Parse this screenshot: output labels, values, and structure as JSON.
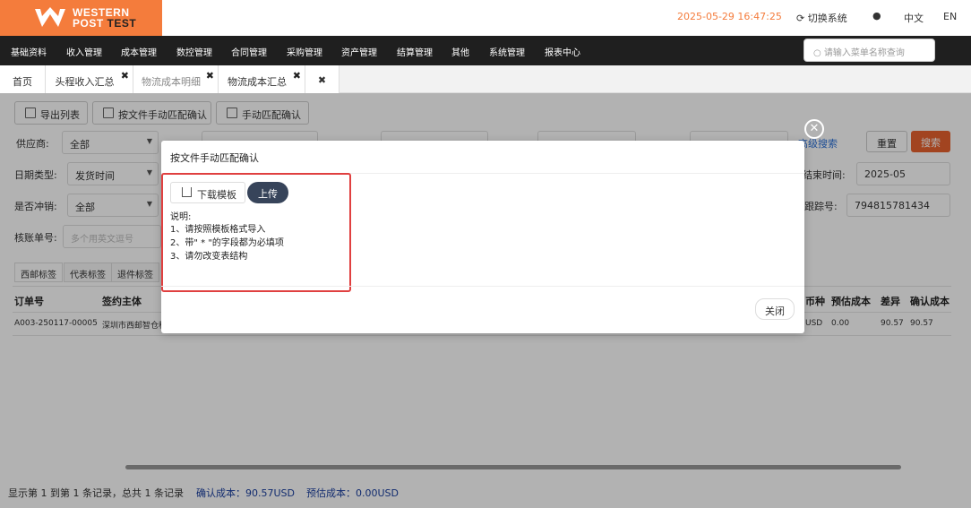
{
  "brand": {
    "line1": "WESTERN",
    "line2a": "POST ",
    "line2b": "TEST"
  },
  "header": {
    "clock": "2025-05-29 16:47:25",
    "switch_label": "切换系统",
    "lang_zh": "中文",
    "lang_en": "EN"
  },
  "menu": {
    "items": [
      "基础资料",
      "收入管理",
      "成本管理",
      "数控管理",
      "合同管理",
      "采购管理",
      "资产管理",
      "结算管理",
      "其他",
      "系统管理",
      "报表中心"
    ],
    "search_placeholder": "请输入菜单名称查询"
  },
  "tabs": [
    {
      "label": "首页"
    },
    {
      "label": "头程收入汇总"
    },
    {
      "label": "物流成本明细"
    },
    {
      "label": "物流成本汇总"
    }
  ],
  "toolbar": {
    "export": "导出列表",
    "file_match": "按文件手动匹配确认",
    "manual_match": "手动匹配确认"
  },
  "filters": {
    "supplier_label": "供应商:",
    "supplier_value": "全部",
    "date_type_label": "日期类型:",
    "date_type_value": "发货时间",
    "offset_label": "是否冲销:",
    "offset_value": "全部",
    "account_no_label": "核账单号:",
    "account_no_placeholder": "多个用英文逗号",
    "end_time_label": "结束时间:",
    "end_time_value": "2025-05",
    "tracking_label": "跟踪号:",
    "tracking_value": "794815781434",
    "advanced": "高级搜索",
    "reset": "重置",
    "search": "搜索"
  },
  "subtabs": [
    "西邮标签",
    "代表标签",
    "退件标签"
  ],
  "table": {
    "headers": {
      "order_no": "订单号",
      "entity": "签约主体",
      "currency": "币种",
      "est_cost": "预估成本",
      "diff": "差异",
      "confirmed_cost": "确认成本"
    },
    "row": {
      "order_no": "A003-250117-00005",
      "entity": "深圳市西邮智仓科",
      "currency": "USD",
      "est_cost": "0.00",
      "diff": "90.57",
      "confirmed_cost": "90.57"
    }
  },
  "footer": {
    "summary": "显示第 1 到第 1 条记录，总共 1 条记录",
    "confirmed": "确认成本：90.57USD",
    "estimated": "预估成本：0.00USD"
  },
  "modal": {
    "title": "按文件手动匹配确认",
    "download": "下载模板",
    "upload": "上传",
    "notes": [
      "说明:",
      "1、请按照模板格式导入",
      "2、带\" * \"的字段都为必填项",
      "3、请勿改变表结构"
    ],
    "close": "关闭"
  }
}
